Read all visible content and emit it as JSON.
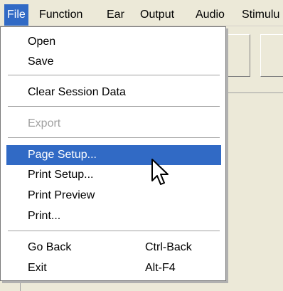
{
  "menubar": {
    "items": [
      {
        "label": "File"
      },
      {
        "label": "Function"
      },
      {
        "label": "Ear"
      },
      {
        "label": "Output"
      },
      {
        "label": "Audio"
      },
      {
        "label": "Stimulu"
      }
    ]
  },
  "file_menu": {
    "items": [
      {
        "label": "Open"
      },
      {
        "label": "Save"
      },
      {
        "label": "Clear Session Data"
      },
      {
        "label": "Export",
        "disabled": true
      },
      {
        "label": "Page Setup...",
        "selected": true
      },
      {
        "label": "Print Setup..."
      },
      {
        "label": "Print Preview"
      },
      {
        "label": "Print..."
      },
      {
        "label": "Go Back",
        "shortcut": "Ctrl-Back"
      },
      {
        "label": "Exit",
        "shortcut": "Alt-F4"
      }
    ]
  },
  "colors": {
    "highlight": "#316ac5",
    "menubar_bg": "#ece9d8",
    "disabled_text": "#a0a0a0"
  },
  "cursor": {
    "icon": "arrow-pointer-icon"
  }
}
